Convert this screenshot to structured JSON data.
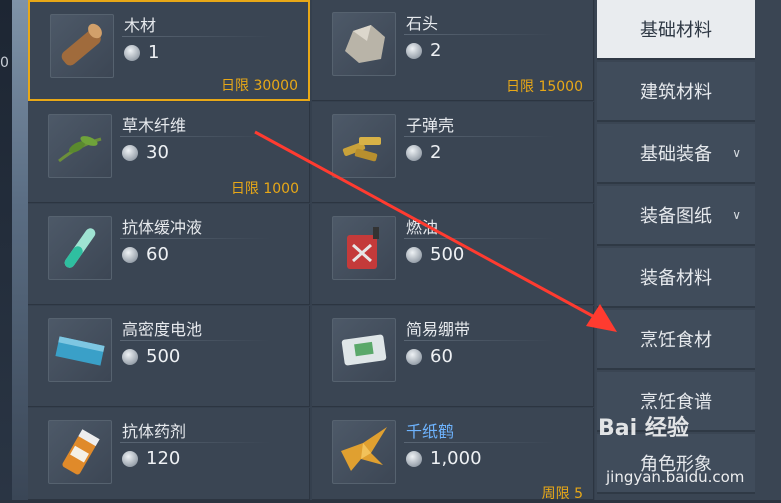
{
  "left_stub": "0",
  "items": [
    {
      "name": "木材",
      "price": "1",
      "limit": "日限 30000",
      "icon": "wood-icon",
      "selected": true
    },
    {
      "name": "石头",
      "price": "2",
      "limit": "日限 15000",
      "icon": "stone-icon"
    },
    {
      "name": "草木纤维",
      "price": "30",
      "limit": "日限 1000",
      "icon": "plant-fiber-icon"
    },
    {
      "name": "子弹壳",
      "price": "2",
      "limit": "",
      "icon": "bullet-casing-icon"
    },
    {
      "name": "抗体缓冲液",
      "price": "60",
      "limit": "",
      "icon": "test-tube-icon"
    },
    {
      "name": "燃油",
      "price": "500",
      "limit": "",
      "icon": "fuel-can-icon"
    },
    {
      "name": "高密度电池",
      "price": "500",
      "limit": "",
      "icon": "battery-icon"
    },
    {
      "name": "简易绷带",
      "price": "60",
      "limit": "",
      "icon": "bandage-icon"
    },
    {
      "name": "抗体药剂",
      "price": "120",
      "limit": "",
      "icon": "medicine-bottle-icon"
    },
    {
      "name": "千纸鹤",
      "price": "1,000",
      "limit": "周限 5",
      "icon": "paper-crane-icon",
      "special": true
    }
  ],
  "sidebar": {
    "tabs": [
      {
        "label": "基础材料",
        "active": true
      },
      {
        "label": "建筑材料"
      },
      {
        "label": "基础装备",
        "chevron": true
      },
      {
        "label": "装备图纸",
        "chevron": true
      },
      {
        "label": "装备材料"
      },
      {
        "label": "烹饪食材"
      },
      {
        "label": "烹饪食谱"
      },
      {
        "label": "角色形象"
      }
    ]
  },
  "watermark": {
    "text": "Bai 经验",
    "sub": "jingyan.baidu.com"
  },
  "colors": {
    "selected_border": "#e8a817",
    "limit_text": "#e8a817",
    "special_name": "#6eb4ff",
    "arrow": "#ff3b30"
  }
}
